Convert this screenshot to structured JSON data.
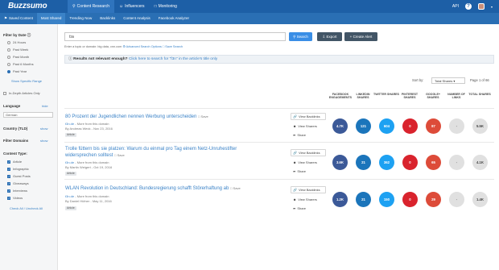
{
  "app": {
    "logo": "Buzzsumo",
    "top_nav": [
      {
        "label": "Content Research",
        "icon": "magnifier-icon",
        "active": true
      },
      {
        "label": "Influencers",
        "icon": "people-icon",
        "active": false
      },
      {
        "label": "Monitoring",
        "icon": "monitor-icon",
        "active": false
      }
    ],
    "api_label": "API",
    "sub_nav": [
      {
        "label": "Saved Content",
        "active": false
      },
      {
        "label": "Most Shared",
        "active": true
      },
      {
        "label": "Trending Now",
        "active": false
      },
      {
        "label": "Backlinks",
        "active": false
      },
      {
        "label": "Content Analysis",
        "active": false
      },
      {
        "label": "Facebook Analyzer",
        "active": false
      }
    ]
  },
  "sidebar": {
    "date_title": "Filter by Date",
    "date_options": [
      {
        "label": "24 Hours",
        "selected": false
      },
      {
        "label": "Past Week",
        "selected": false
      },
      {
        "label": "Past Month",
        "selected": false
      },
      {
        "label": "Past 6 Months",
        "selected": false
      },
      {
        "label": "Past Year",
        "selected": true
      }
    ],
    "specific_range": "Show Specific Range",
    "in_depth": "In-Depth Articles Only",
    "language_title": "Language",
    "language_value": "German",
    "country_title": "Country (TLD)",
    "show_label": "show",
    "hide_label": "hide",
    "filter_domains_title": "Filter Domains",
    "content_type_title": "Content Type:",
    "content_types": [
      "Article",
      "Infographic",
      "Guest Posts",
      "Giveaways",
      "Interviews",
      "Videos"
    ],
    "check_all": "Check All / Uncheck All"
  },
  "search": {
    "value": "f3n",
    "button": "Search",
    "export": "Export",
    "create_alert": "Create Alert",
    "hint_prefix": "Enter a topic or domain: big data, cnn.com",
    "advanced": "Advanced Search Options",
    "save": "Save Search"
  },
  "notice": {
    "bold": "Results not relevant enough?",
    "link": "Click here to search for \"f3n\" in the article's title only"
  },
  "sort": {
    "label": "Sort by:",
    "value": "Total Shares",
    "page": "Page 1 of 66"
  },
  "columns": [
    "FACEBOOK ENGAGEMENTS",
    "LINKEDIN SHARES",
    "TWITTER SHARES",
    "PINTEREST SHARES",
    "GOOGLE+ SHARES",
    "NUMBER OF LINKS",
    "TOTAL SHARES"
  ],
  "actions": [
    "View Backlinks",
    "View Sharers",
    "Share"
  ],
  "colors": {
    "facebook": "#3b5998",
    "linkedin": "#1b75bb",
    "twitter": "#1da1f2",
    "pinterest": "#d9232d",
    "google": "#dd4b39",
    "links": "#e0e0e0"
  },
  "results": [
    {
      "title": "80 Prozent der Jugendlichen nennen Werbung unterscheiden",
      "save": "Save",
      "domain": "t3n.de",
      "more": "More from this domain",
      "author": "By Andreas Weck",
      "date": "Nov 23, 2016",
      "type": "Article",
      "metrics": [
        "4.7K",
        "121",
        "604",
        "0",
        "87",
        "-",
        "5.5K"
      ]
    },
    {
      "title": "Trolle füttern bis sie platzen: Warum du einmal pro Tag einem Netz-Unruhestifter widersprechen solltest",
      "save": "Save",
      "domain": "t3n.de",
      "more": "More from this domain",
      "author": "By Martin Weigert",
      "date": "Oct 19, 2016",
      "type": "Article",
      "metrics": [
        "3.6K",
        "21",
        "362",
        "0",
        "65",
        "-",
        "4.1K"
      ]
    },
    {
      "title": "WLAN Revolution in Deutschland: Bundesregierung schafft Störerhaftung ab",
      "save": "Save",
      "domain": "t3n.de",
      "more": "More from this domain",
      "author": "By Daniel Hüfner",
      "date": "May 11, 2016",
      "type": "Article",
      "metrics": [
        "1.2K",
        "21",
        "150",
        "0",
        "29",
        "-",
        "1.4K"
      ]
    }
  ]
}
